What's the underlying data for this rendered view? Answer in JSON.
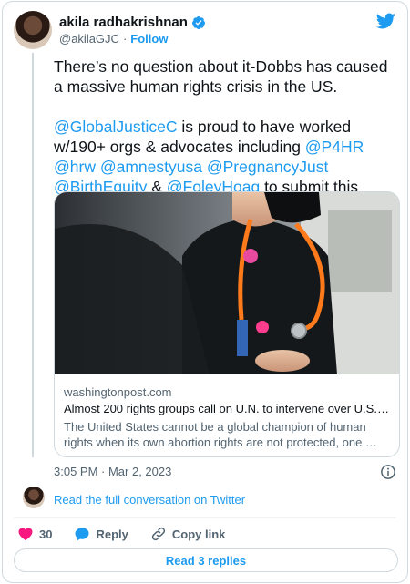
{
  "author": {
    "name": "akila radhakrishnan",
    "handle": "@akilaGJC",
    "separator": "·",
    "follow_label": "Follow"
  },
  "tweet": {
    "para1": "There’s no question about it-Dobbs has caused a massive human rights crisis in the US.",
    "mention1": "@GlobalJusticeC",
    "text1": " is proud to have worked w/190+ orgs & advocates  including ",
    "mention2": "@P4HR",
    "text2": " ",
    "mention3": "@hrw",
    "text3": " ",
    "mention4": "@amnestyusa",
    "text4": " ",
    "mention5": "@PregnancyJust",
    "text5": " ",
    "mention6": "@BirthEquity",
    "text6": " & ",
    "mention7": "@FoleyHoag",
    "text7": " to submit this urgent call."
  },
  "link_card": {
    "domain": "washingtonpost.com",
    "title": "Almost 200 rights groups call on U.N. to intervene over U.S. …",
    "description": "The United States cannot be a global champion of human rights when its own abortion rights are not protected, one …"
  },
  "timestamp": "3:05 PM · Mar 2, 2023",
  "conversation_link": "Read the full conversation on Twitter",
  "actions": {
    "like_count": "30",
    "reply_label": "Reply",
    "copy_label": "Copy link"
  },
  "read_replies": "Read 3 replies",
  "colors": {
    "accent": "#1d9bf0",
    "like": "#f91880",
    "secondary_text": "#536471",
    "border": "#cfd9de"
  },
  "icons": [
    "verified-badge-icon",
    "twitter-logo-icon",
    "info-icon",
    "heart-icon",
    "reply-bubble-icon",
    "link-icon"
  ]
}
